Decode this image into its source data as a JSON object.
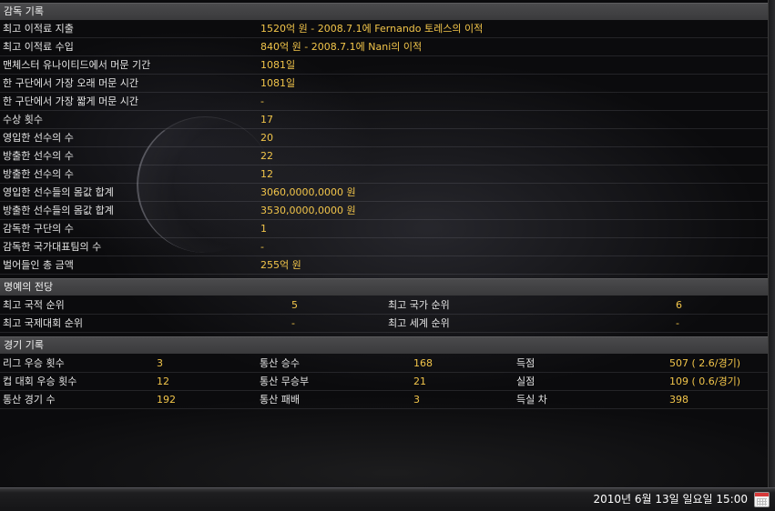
{
  "sections": {
    "manager": "감독 기록",
    "honor": "명예의 전당",
    "match": "경기 기록"
  },
  "manager_rows": [
    {
      "label": "최고 이적료 지출",
      "value": "1520억 원 - 2008.7.1에 Fernando 토레스의 이적"
    },
    {
      "label": "최고 이적료 수입",
      "value": "840억 원 - 2008.7.1에 Nani의 이적"
    },
    {
      "label": "맨체스터 유나이티드에서 머문 기간",
      "value": "1081일"
    },
    {
      "label": "한 구단에서 가장 오래 머문 시간",
      "value": "1081일"
    },
    {
      "label": "한 구단에서 가장 짧게 머문 시간",
      "value": "-"
    },
    {
      "label": "수상 횟수",
      "value": "17"
    },
    {
      "label": "영입한 선수의 수",
      "value": "20"
    },
    {
      "label": "방출한 선수의 수",
      "value": "22"
    },
    {
      "label": "방출한 선수의 수",
      "value": "12"
    },
    {
      "label": "영입한 선수들의 몸값 합계",
      "value": "3060,0000,0000 원"
    },
    {
      "label": "방출한 선수들의 몸값 합계",
      "value": "3530,0000,0000 원"
    },
    {
      "label": "감독한 구단의 수",
      "value": "1"
    },
    {
      "label": "감독한 국가대표팀의 수",
      "value": "-"
    },
    {
      "label": "벌어들인 총 금액",
      "value": "255억 원"
    }
  ],
  "honor_rows": [
    {
      "label1": "최고 국적 순위",
      "value1": "5",
      "label2": "최고 국가 순위",
      "value2": "6"
    },
    {
      "label1": "최고 국제대회 순위",
      "value1": "-",
      "label2": "최고 세계 순위",
      "value2": "-"
    }
  ],
  "match_rows": [
    {
      "c1l": "리그 우승 횟수",
      "c1v": "3",
      "c2l": "통산 승수",
      "c2v": "168",
      "c3l": "득점",
      "c3v": "507 ( 2.6/경기)"
    },
    {
      "c1l": "컵 대회 우승 횟수",
      "c1v": "12",
      "c2l": "통산 무승부",
      "c2v": "21",
      "c3l": "실점",
      "c3v": "109 ( 0.6/경기)"
    },
    {
      "c1l": "통산 경기 수",
      "c1v": "192",
      "c2l": "통산 패배",
      "c2v": "3",
      "c3l": "득실 차",
      "c3v": "398"
    }
  ],
  "taskbar": {
    "clock": "2010년 6월 13일 일요일 15:00"
  },
  "colors": {
    "value": "#f2c54a",
    "header_bg": "#404042"
  },
  "icons": {
    "calendar": "calendar-icon"
  }
}
